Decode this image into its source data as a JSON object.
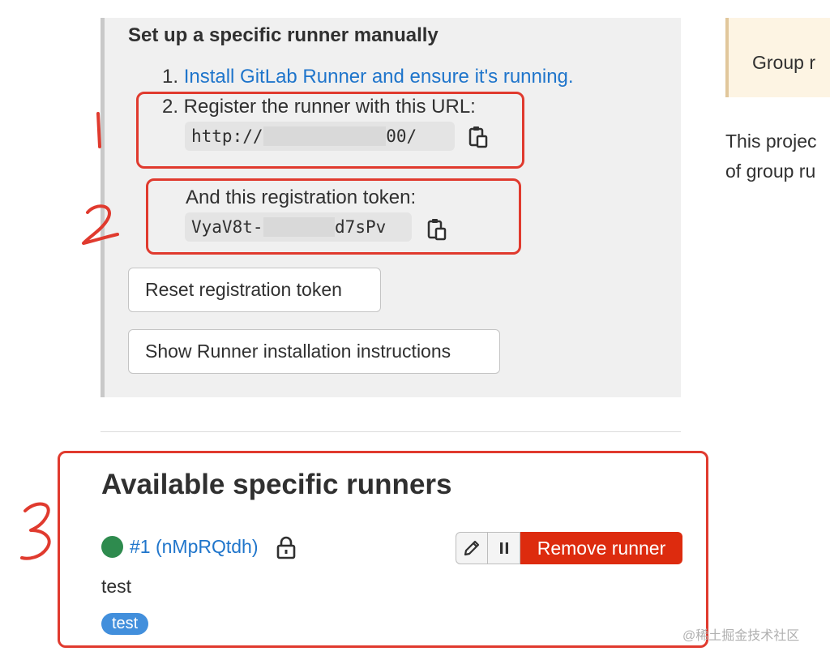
{
  "setup": {
    "title": "Set up a specific runner manually",
    "step1_prefix": "1.",
    "step1_link": "Install GitLab Runner and ensure it's running.",
    "step2_text": "2. Register the runner with this URL:",
    "url_visible_start": "http://",
    "url_visible_end": "00/",
    "token_label": "And this registration token:",
    "token_visible_start": "VyaV8t-",
    "token_visible_end": "d7sPv",
    "reset_button": "Reset registration token",
    "show_button": "Show Runner installation instructions"
  },
  "runners": {
    "title": "Available specific runners",
    "items": [
      {
        "id_label": "#1 (nMpRQtdh)",
        "status_color": "#2e8b4e",
        "description": "test",
        "tag": "test",
        "remove_label": "Remove runner"
      }
    ]
  },
  "right": {
    "box_text": "Group r",
    "desc_line1": "This projec",
    "desc_line2": "of group ru"
  },
  "annotations": [
    "1",
    "2",
    "3"
  ],
  "watermark": "@稀土掘金技术社区",
  "colors": {
    "link": "#1f75cb",
    "danger": "#dd2b0e",
    "annotation": "#e03a2e",
    "tag": "#428fdc"
  }
}
